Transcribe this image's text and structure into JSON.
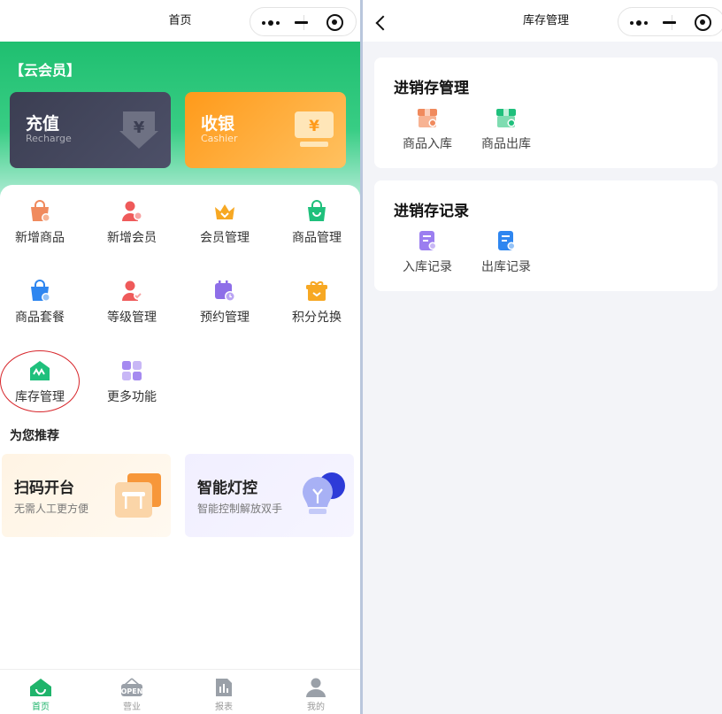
{
  "home": {
    "nav_title": "首页",
    "member_tag": "【云会员】",
    "cards": {
      "recharge": {
        "title": "充值",
        "subtitle": "Recharge"
      },
      "cashier": {
        "title": "收银",
        "subtitle": "Cashier"
      }
    },
    "grid": [
      {
        "label": "新增商品",
        "icon": "product-bag-add-icon"
      },
      {
        "label": "新增会员",
        "icon": "member-add-icon"
      },
      {
        "label": "会员管理",
        "icon": "crown-icon"
      },
      {
        "label": "商品管理",
        "icon": "shopping-bag-icon"
      },
      {
        "label": "商品套餐",
        "icon": "bag-combo-icon"
      },
      {
        "label": "等级管理",
        "icon": "member-level-icon"
      },
      {
        "label": "预约管理",
        "icon": "calendar-clock-icon"
      },
      {
        "label": "积分兑换",
        "icon": "gift-box-icon"
      },
      {
        "label": "库存管理",
        "icon": "inventory-house-icon"
      },
      {
        "label": "更多功能",
        "icon": "grid-more-icon"
      }
    ],
    "recommend": {
      "title": "为您推荐",
      "cards": [
        {
          "title": "扫码开台",
          "subtitle": "无需人工更方便"
        },
        {
          "title": "智能灯控",
          "subtitle": "智能控制解放双手"
        }
      ]
    },
    "tabs": [
      {
        "label": "首页",
        "active": true
      },
      {
        "label": "营业",
        "active": false
      },
      {
        "label": "报表",
        "active": false
      },
      {
        "label": "我的",
        "active": false
      }
    ],
    "colors": {
      "brand_green": "#1fb46b",
      "highlight_red": "#d7262b"
    }
  },
  "inventory": {
    "nav_title": "库存管理",
    "sections": [
      {
        "title": "进销存管理",
        "items": [
          {
            "label": "商品入库"
          },
          {
            "label": "商品出库"
          }
        ]
      },
      {
        "title": "进销存记录",
        "items": [
          {
            "label": "入库记录"
          },
          {
            "label": "出库记录"
          }
        ]
      }
    ]
  }
}
